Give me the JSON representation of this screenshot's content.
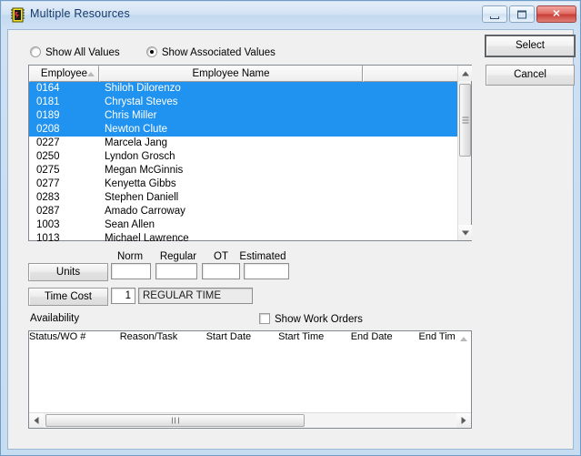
{
  "window": {
    "title": "Multiple Resources",
    "icon": "resource-chip-icon",
    "controls": {
      "minimize": "minimize-button",
      "maximize": "maximize-button",
      "close_label": "✕"
    }
  },
  "options": {
    "show_all_label": "Show All Values",
    "show_associated_label": "Show Associated Values",
    "selected": "show_associated"
  },
  "employee_list": {
    "columns": [
      "Employee",
      "Employee Name",
      ""
    ],
    "sort_column": "Employee",
    "sort_direction": "ascending",
    "rows": [
      {
        "id": "0164",
        "name": "Shiloh Dilorenzo",
        "selected": true
      },
      {
        "id": "0181",
        "name": "Chrystal Steves",
        "selected": true
      },
      {
        "id": "0189",
        "name": "Chris Miller",
        "selected": true
      },
      {
        "id": "0208",
        "name": "Newton Clute",
        "selected": true
      },
      {
        "id": "0227",
        "name": "Marcela Jang",
        "selected": false
      },
      {
        "id": "0250",
        "name": "Lyndon Grosch",
        "selected": false
      },
      {
        "id": "0275",
        "name": "Megan McGinnis",
        "selected": false
      },
      {
        "id": "0277",
        "name": "Kenyetta Gibbs",
        "selected": false
      },
      {
        "id": "0283",
        "name": "Stephen Daniell",
        "selected": false
      },
      {
        "id": "0287",
        "name": "Amado Carroway",
        "selected": false
      },
      {
        "id": "1003",
        "name": "Sean Allen",
        "selected": false
      },
      {
        "id": "1013",
        "name": "Michael Lawrence",
        "selected": false
      }
    ]
  },
  "units_section": {
    "column_headers": [
      "Norm",
      "Regular",
      "OT",
      "Estimated"
    ],
    "units_button_label": "Units",
    "time_cost_button_label": "Time Cost",
    "norm_value": "",
    "regular_value": "",
    "ot_value": "",
    "estimated_value": "",
    "time_cost_code": "1",
    "time_cost_description": "REGULAR TIME"
  },
  "availability": {
    "label": "Availability",
    "show_work_orders_label": "Show Work Orders",
    "show_work_orders_checked": false,
    "columns": [
      "Status/WO #",
      "Reason/Task",
      "Start Date",
      "Start Time",
      "End Date",
      "End Tim"
    ],
    "sort_column": "Status/WO #",
    "rows": []
  },
  "actions": {
    "select_label": "Select",
    "cancel_label": "Cancel"
  },
  "colors": {
    "selection_blue": "#2092f0",
    "dialog_face": "#f0f0f0",
    "frame_blue": "#c6dcf0",
    "title_text": "#13386b"
  }
}
